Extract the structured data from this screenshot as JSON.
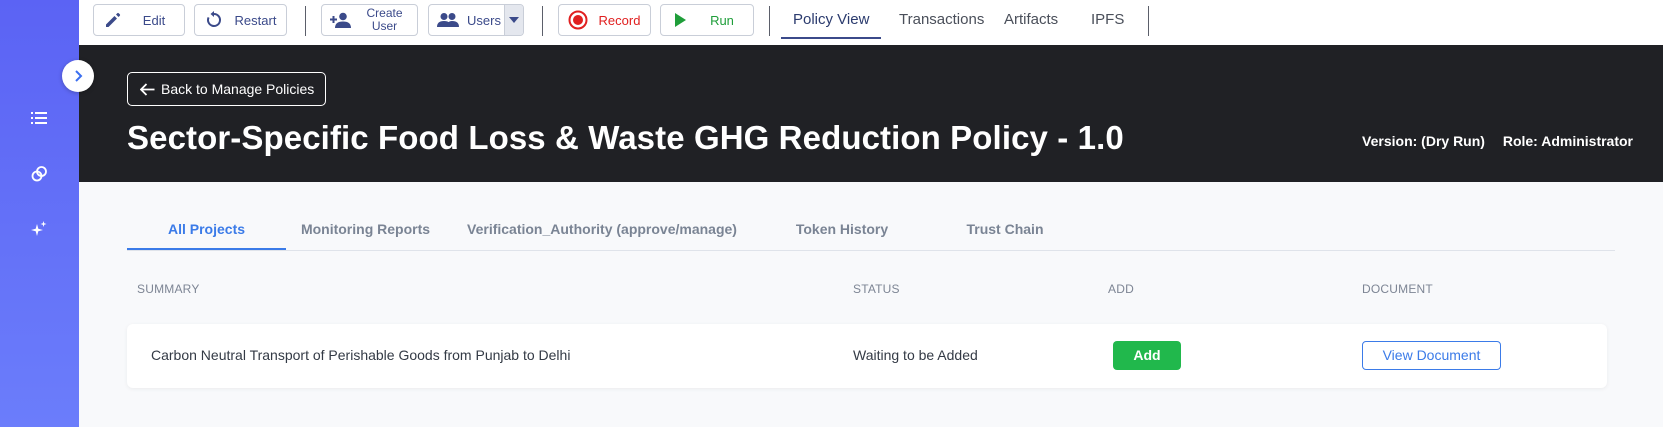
{
  "toolbar": {
    "edit_label": "Edit",
    "restart_label": "Restart",
    "create_user_line1": "Create",
    "create_user_line2": "User",
    "users_label": "Users",
    "record_label": "Record",
    "run_label": "Run",
    "nav_tabs": [
      {
        "label": "Policy View"
      },
      {
        "label": "Transactions"
      },
      {
        "label": "Artifacts"
      },
      {
        "label": "IPFS"
      }
    ]
  },
  "header": {
    "back_label": "Back to Manage Policies",
    "title": "Sector-Specific Food Loss & Waste GHG Reduction Policy - 1.0",
    "version": "Version: (Dry Run)",
    "role": "Role: Administrator"
  },
  "tabs": [
    {
      "label": "All Projects"
    },
    {
      "label": "Monitoring Reports"
    },
    {
      "label": "Verification_Authority (approve/manage)"
    },
    {
      "label": "Token History"
    },
    {
      "label": "Trust Chain"
    }
  ],
  "table": {
    "columns": [
      "SUMMARY",
      "STATUS",
      "ADD",
      "DOCUMENT"
    ],
    "rows": [
      {
        "summary": "Carbon Neutral Transport of Perishable Goods from Punjab to Delhi",
        "status": "Waiting to be Added",
        "add_label": "Add",
        "document_label": "View Document"
      }
    ]
  },
  "colors": {
    "sidebar": "#5b63f4",
    "header_bg": "#202125",
    "accent": "#3b7be8",
    "add_green": "#21b84c",
    "record_red": "#e02020",
    "run_green": "#1f9e3a"
  }
}
